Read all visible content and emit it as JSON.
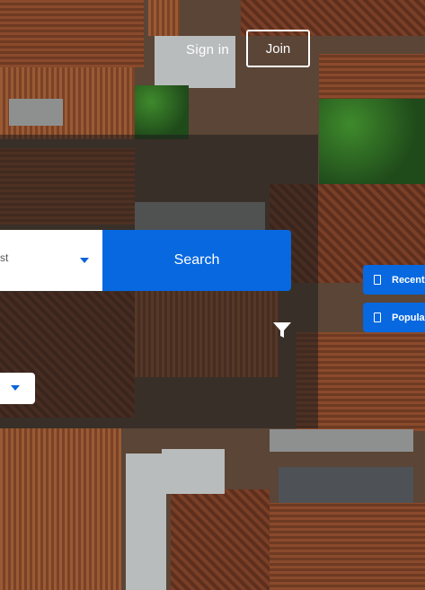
{
  "nav": {
    "signin_label": "Sign in",
    "join_label": "Join"
  },
  "search": {
    "select_value": "st",
    "button_label": "Search"
  },
  "sidebar": {
    "recent_label": "Recent",
    "popular_label": "Popular"
  },
  "colors": {
    "accent": "#0768e0",
    "overlay": "rgba(30,30,30,0.55)",
    "text_light": "#ffffff"
  },
  "icons": {
    "filter": "filter-icon",
    "dropdown": "chevron-down-icon",
    "recent": "document-icon",
    "popular": "document-icon"
  }
}
